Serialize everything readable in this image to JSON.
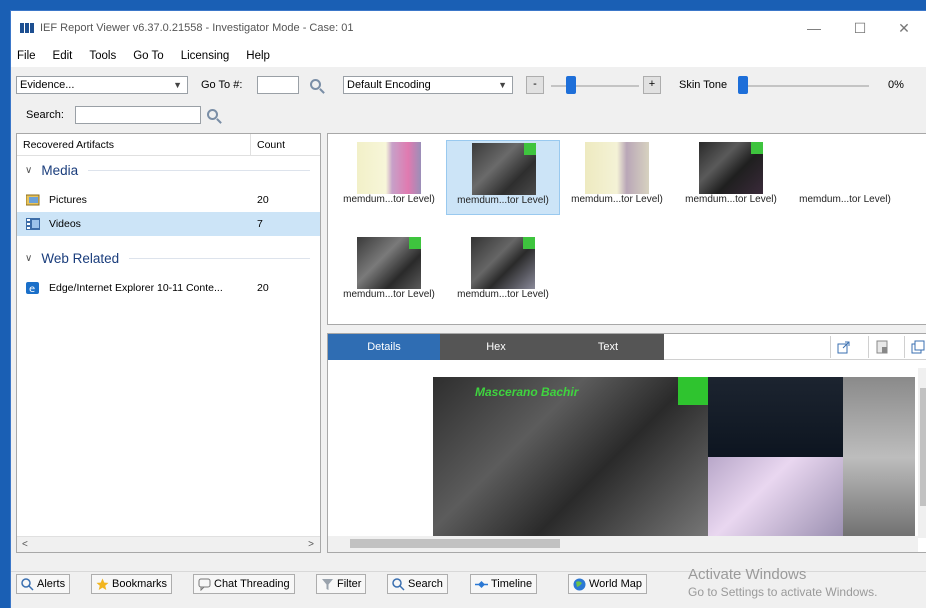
{
  "window": {
    "title": "IEF Report Viewer v6.37.0.21558 - Investigator Mode - Case: 01",
    "min_glyph": "—",
    "max_glyph": "☐",
    "close_glyph": "✕"
  },
  "menu": [
    "File",
    "Edit",
    "Tools",
    "Go To",
    "Licensing",
    "Help"
  ],
  "toolbar": {
    "evidence_value": "Evidence...",
    "goto_label": "Go To #:",
    "goto_value": "",
    "encoding_value": "Default Encoding",
    "zoom_minus": "-",
    "zoom_plus": "+",
    "skin_tone_label": "Skin Tone",
    "skin_tone_value": "0%",
    "search_label": "Search:",
    "search_value": ""
  },
  "left_pane": {
    "col_artifacts": "Recovered Artifacts",
    "col_count": "Count",
    "groups": [
      {
        "name": "Media",
        "items": [
          {
            "label": "Pictures",
            "count": "20",
            "icon": "pictures-icon"
          },
          {
            "label": "Videos",
            "count": "7",
            "icon": "videos-icon"
          }
        ]
      },
      {
        "name": "Web Related",
        "items": [
          {
            "label": "Edge/Internet Explorer 10-11 Conte...",
            "count": "20",
            "icon": "edge-ie-icon"
          }
        ]
      }
    ],
    "scroll_left": "<",
    "scroll_right": ">"
  },
  "thumbnails": [
    {
      "caption": "memdum...tor Level)"
    },
    {
      "caption": "memdum...tor Level)"
    },
    {
      "caption": "memdum...tor Level)"
    },
    {
      "caption": "memdum...tor Level)"
    },
    {
      "caption": "memdum...tor Level)"
    },
    {
      "caption": "memdum...tor Level)"
    },
    {
      "caption": "memdum...tor Level)"
    }
  ],
  "detail_tabs": [
    "Details",
    "Hex",
    "Text"
  ],
  "preview": {
    "overlay_text": "Mascerano Bachir"
  },
  "bottom_buttons": [
    {
      "label": "Alerts",
      "icon": "alerts-icon"
    },
    {
      "label": "Bookmarks",
      "icon": "bookmark-star-icon"
    },
    {
      "label": "Chat Threading",
      "icon": "chat-icon"
    },
    {
      "label": "Filter",
      "icon": "filter-icon"
    },
    {
      "label": "Search",
      "icon": "search-icon"
    },
    {
      "label": "Timeline",
      "icon": "timeline-icon"
    },
    {
      "label": "World Map",
      "icon": "globe-icon"
    }
  ],
  "watermark": {
    "line1": "Activate Windows",
    "line2": "Go to Settings to activate Windows."
  },
  "colors": {
    "accent_blue": "#1e6fd9",
    "tab_active": "#2f6db3",
    "tab_inactive": "#555555",
    "selection": "#cce4f7"
  }
}
